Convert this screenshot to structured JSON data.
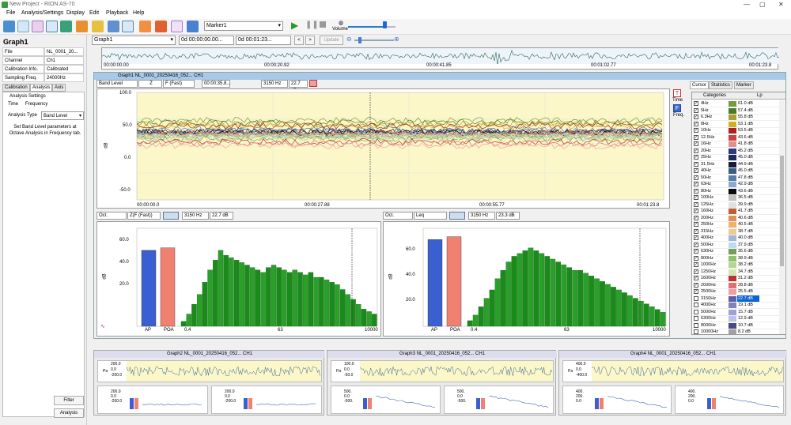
{
  "window": {
    "title": "New Project - RION AS-70"
  },
  "menu": [
    "File",
    "Analysis/Settings",
    "Display",
    "Edit",
    "Playback",
    "Help"
  ],
  "toolbar": {
    "marker": "Marker1",
    "volume_label": "Volume"
  },
  "graph_select": {
    "graph": "Graph1",
    "start": "0d 00:00:00.00...",
    "end": "0d 00:01:23...",
    "update": "Update"
  },
  "overview": {
    "t0": "00:00:00.00",
    "t1": "00:00:20.92",
    "t2": "00:00:41.85",
    "t3": "00:01:02.77",
    "t4": "00:01:23.8"
  },
  "left": {
    "title": "Graph1",
    "props": [
      {
        "k": "File",
        "v": "NL_0001_20..."
      },
      {
        "k": "Channel",
        "v": "Ch1"
      },
      {
        "k": "Calibration Info.",
        "v": "Calibrated"
      },
      {
        "k": "Sampling Freq.",
        "v": "24000Hz"
      }
    ],
    "tabs": [
      "Calibration",
      "Analysis",
      "Axis"
    ],
    "section": "Analysis Settings",
    "subtabs": [
      "Time",
      "Frequency"
    ],
    "analysis_type_label": "Analysis Type",
    "analysis_type_value": "Band Level",
    "note": "Set Band Level parameters at Octave Analysis in Frequency tab.",
    "filter_btn": "Filter",
    "analysis_btn": "Analysis"
  },
  "graph1": {
    "title": "Graph1 NL_0001_20250416_052... CH1",
    "band_level": "Band Level",
    "weighting": "Z",
    "time_weight": "F (Fast)",
    "time": "00:00:35.8...",
    "freq": "3150 Hz",
    "level": "22.7 dB",
    "y_ticks": [
      "100.0",
      "50.0",
      "0.0",
      "-50.0"
    ],
    "x_labels": [
      "00:00:00.0",
      "00:00:27.88",
      "00:00:55.77",
      "00:01:23.8"
    ],
    "time_btn": "Time",
    "freq_btn": "Freq."
  },
  "spec1": {
    "mode": "Oct.",
    "weight": "Z(F (Fast))",
    "freq": "3150 Hz",
    "level": "22.7 dB",
    "y_ticks": [
      "60.0",
      "40.0",
      "20.0"
    ],
    "x_labels": [
      "AP",
      "POA",
      "0.4",
      "63",
      "10000"
    ]
  },
  "spec2": {
    "mode": "Oct.",
    "weight": "Leq",
    "freq": "3150 Hz",
    "level": "23.3 dB",
    "y_ticks": [
      "60.0",
      "40.0",
      "20.0"
    ],
    "x_labels": [
      "AP",
      "POA",
      "0.4",
      "63",
      "10000"
    ]
  },
  "right_tabs": [
    "Cursor",
    "Statistics",
    "Marker"
  ],
  "cat_header": {
    "c": "Categories",
    "lp": "Lp"
  },
  "categories": [
    {
      "n": "4Hz",
      "v": "61.0 dB",
      "c": "#7a9a3a",
      "on": true
    },
    {
      "n": "5Hz",
      "v": "57.4 dB",
      "c": "#4a7a2a",
      "on": true
    },
    {
      "n": "6.3Hz",
      "v": "55.8 dB",
      "c": "#aaa030",
      "on": true
    },
    {
      "n": "8Hz",
      "v": "53.1 dB",
      "c": "#d0b020",
      "on": true
    },
    {
      "n": "10Hz",
      "v": "53.5 dB",
      "c": "#b02020",
      "on": true
    },
    {
      "n": "12.5Hz",
      "v": "43.6 dB",
      "c": "#d04040",
      "on": true
    },
    {
      "n": "16Hz",
      "v": "41.8 dB",
      "c": "#e09090",
      "on": true
    },
    {
      "n": "20Hz",
      "v": "45.2 dB",
      "c": "#2a3a7a",
      "on": true
    },
    {
      "n": "25Hz",
      "v": "45.0 dB",
      "c": "#1a2a5a",
      "on": true
    },
    {
      "n": "31.5Hz",
      "v": "44.9 dB",
      "c": "#1a1a3a",
      "on": true
    },
    {
      "n": "40Hz",
      "v": "45.0 dB",
      "c": "#3a5a8a",
      "on": true
    },
    {
      "n": "50Hz",
      "v": "47.8 dB",
      "c": "#5a7aaa",
      "on": true
    },
    {
      "n": "63Hz",
      "v": "42.9 dB",
      "c": "#8aaad0",
      "on": true
    },
    {
      "n": "80Hz",
      "v": "43.6 dB",
      "c": "#0a0a0a",
      "on": true
    },
    {
      "n": "100Hz",
      "v": "36.5 dB",
      "c": "#c0c0c0",
      "on": true
    },
    {
      "n": "125Hz",
      "v": "39.9 dB",
      "c": "#e0e0e0",
      "on": true
    },
    {
      "n": "160Hz",
      "v": "41.7 dB",
      "c": "#c06030",
      "on": true
    },
    {
      "n": "200Hz",
      "v": "40.6 dB",
      "c": "#e09050",
      "on": true
    },
    {
      "n": "250Hz",
      "v": "40.5 dB",
      "c": "#f0b070",
      "on": true
    },
    {
      "n": "315Hz",
      "v": "38.7 dB",
      "c": "#f0c890",
      "on": true
    },
    {
      "n": "400Hz",
      "v": "40.0 dB",
      "c": "#a0b8d8",
      "on": true
    },
    {
      "n": "500Hz",
      "v": "37.9 dB",
      "c": "#c0d8f0",
      "on": true
    },
    {
      "n": "630Hz",
      "v": "35.6 dB",
      "c": "#70a050",
      "on": true
    },
    {
      "n": "800Hz",
      "v": "38.9 dB",
      "c": "#90c070",
      "on": true
    },
    {
      "n": "1000Hz",
      "v": "38.2 dB",
      "c": "#b0d890",
      "on": true
    },
    {
      "n": "1250Hz",
      "v": "34.7 dB",
      "c": "#d0e8b0",
      "on": true
    },
    {
      "n": "1600Hz",
      "v": "31.2 dB",
      "c": "#c03030",
      "on": true
    },
    {
      "n": "2000Hz",
      "v": "28.8 dB",
      "c": "#e07070",
      "on": true
    },
    {
      "n": "2500Hz",
      "v": "25.5 dB",
      "c": "#f0a0a0",
      "on": true
    },
    {
      "n": "3150Hz",
      "v": "22.7 dB",
      "c": "#6060a0",
      "on": false,
      "hl": true
    },
    {
      "n": "4000Hz",
      "v": "19.1 dB",
      "c": "#8080c0",
      "on": false
    },
    {
      "n": "5000Hz",
      "v": "15.7 dB",
      "c": "#a0a0d8",
      "on": false
    },
    {
      "n": "6300Hz",
      "v": "12.9 dB",
      "c": "#c0c0e8",
      "on": false
    },
    {
      "n": "8000Hz",
      "v": "10.7 dB",
      "c": "#4a4a80",
      "on": false
    },
    {
      "n": "10000Hz",
      "v": "8.2 dB",
      "c": "#a0a0a0",
      "on": false
    }
  ],
  "bottom_graphs": [
    {
      "title": "Graph2 NL_0001_20250416_052... CH1",
      "wy": [
        "200.0",
        "0.0",
        "-200.0"
      ],
      "sy": [
        "200.0",
        "0.0",
        "-200.0"
      ]
    },
    {
      "title": "Graph3 NL_0001_20250416_052... CH1",
      "wy": [
        "100.0",
        "0.0",
        "-50.0"
      ],
      "sy": [
        "500.",
        "0.0",
        "-500."
      ]
    },
    {
      "title": "Graph4 NL_0001_20250416_052... CH1",
      "wy": [
        "400.0",
        "0.0",
        "-400.0"
      ],
      "sy": [
        "400.",
        "200.",
        "0.0"
      ]
    }
  ],
  "spectrum_bars": [
    {
      "label": "AP",
      "color": "#3a5fd0",
      "h": 62
    },
    {
      "label": "POA",
      "color": "#f08070",
      "h": 64
    }
  ]
}
